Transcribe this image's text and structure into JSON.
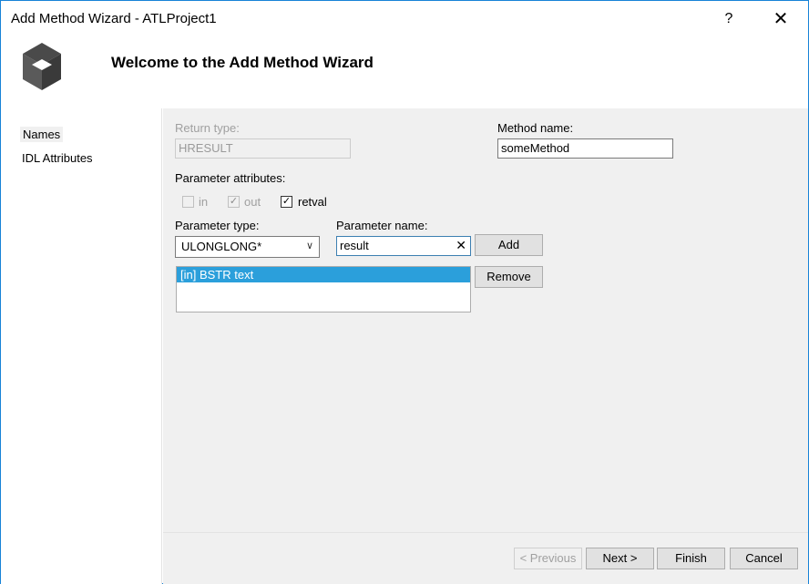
{
  "window": {
    "title": "Add Method Wizard - ATLProject1",
    "help_label": "?",
    "close_label": "✕"
  },
  "header": {
    "welcome": "Welcome to the Add Method Wizard",
    "logo_icon": "cube-icon"
  },
  "nav": {
    "items": [
      {
        "label": "Names",
        "active": true
      },
      {
        "label": "IDL Attributes",
        "active": false
      }
    ]
  },
  "form": {
    "return_type_label": "Return type:",
    "return_type_value": "HRESULT",
    "method_name_label": "Method name:",
    "method_name_value": "someMethod",
    "param_attributes_label": "Parameter attributes:",
    "attr_in_label": "in",
    "attr_out_label": "out",
    "attr_retval_label": "retval",
    "attr_in_checked": false,
    "attr_out_checked": true,
    "attr_retval_checked": true,
    "param_type_label": "Parameter type:",
    "param_type_value": "ULONGLONG*",
    "param_name_label": "Parameter name:",
    "param_name_value": "result",
    "add_label": "Add",
    "remove_label": "Remove",
    "params_list": [
      "[in] BSTR text"
    ]
  },
  "footer": {
    "previous_label": "< Previous",
    "next_label": "Next >",
    "finish_label": "Finish",
    "cancel_label": "Cancel"
  },
  "colors": {
    "accent": "#1883d7",
    "selection": "#2b9fdb",
    "panel": "#f0f0f0"
  }
}
